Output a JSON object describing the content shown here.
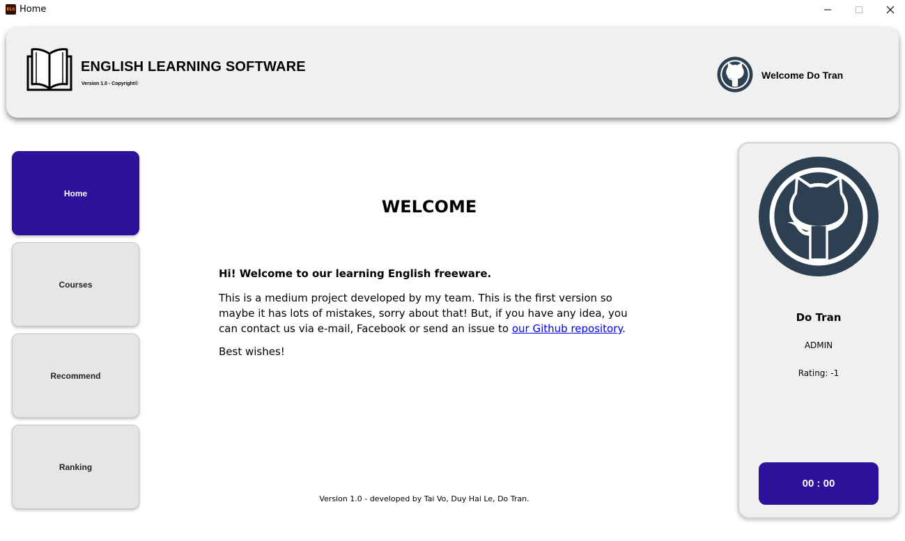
{
  "window": {
    "icon_text": "ELS",
    "title": "Home"
  },
  "header": {
    "app_name": "ENGLISH LEARNING SOFTWARE",
    "version": "Version 1.0 - Copyright©",
    "welcome": "Welcome Do Tran",
    "avatar_icon": "github-octocat-icon",
    "logo_icon": "open-book-icon"
  },
  "nav": {
    "items": [
      {
        "label": "Home",
        "active": true
      },
      {
        "label": "Courses",
        "active": false
      },
      {
        "label": "Recommend",
        "active": false
      },
      {
        "label": "Ranking",
        "active": false
      }
    ]
  },
  "main": {
    "title": "WELCOME",
    "heading": "Hi! Welcome to our learning English freeware.",
    "body_prefix": "This is a medium project developed by my team. This is the first version so maybe it has lots of mistakes, sorry about that! But, if you have any idea, you can contact us via e-mail, Facebook or send an issue to ",
    "link_text": "our Github repository",
    "body_suffix": ".",
    "closing": "Best wishes!",
    "footer": "Version 1.0 - developed by Tai Vo, Duy Hai Le, Do Tran."
  },
  "profile": {
    "name": "Do Tran",
    "role": "ADMIN",
    "rating": "Rating: -1",
    "timer": "00 : 00"
  },
  "colors": {
    "accent": "#2e119b",
    "avatar": "#2c4051",
    "panel": "#f0f0f0"
  }
}
